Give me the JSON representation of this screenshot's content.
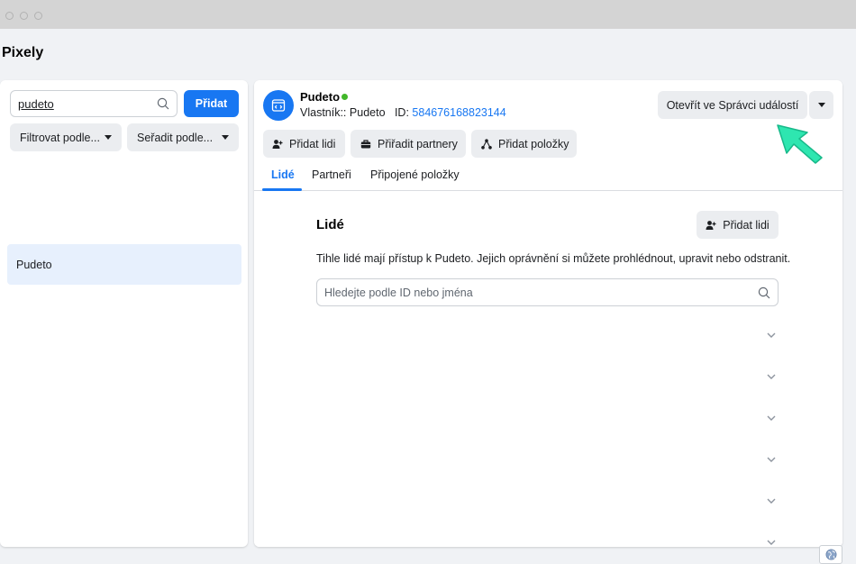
{
  "page_title": "Pixely",
  "left_panel": {
    "search_value": "pudeto",
    "add_button": "Přidat",
    "filter_label": "Filtrovat podle...",
    "sort_label": "Seřadit podle...",
    "items": [
      {
        "label": "Pudeto"
      }
    ]
  },
  "pixel": {
    "name": "Pudeto",
    "owner_label": "Vlastník::",
    "owner_value": "Pudeto",
    "id_label": "ID:",
    "id_value": "584676168823144",
    "status_color": "#42b72a"
  },
  "actions": {
    "open_events_manager": "Otevřít ve Správci událostí",
    "add_people": "Přidat lidi",
    "assign_partners": "Přiřadit partnery",
    "add_assets": "Přidat položky"
  },
  "tabs": [
    {
      "label": "Lidé",
      "active": true
    },
    {
      "label": "Partneři",
      "active": false
    },
    {
      "label": "Připojené položky",
      "active": false
    }
  ],
  "people_section": {
    "title": "Lidé",
    "add_button": "Přidat lidi",
    "description": "Tihle lidé mají přístup k Pudeto. Jejich oprávnění si můžete prohlédnout, upravit nebo odstranit.",
    "search_placeholder": "Hledejte podle ID nebo jména"
  },
  "colors": {
    "accent": "#1877f2",
    "cursor": "#2ee6b0"
  }
}
